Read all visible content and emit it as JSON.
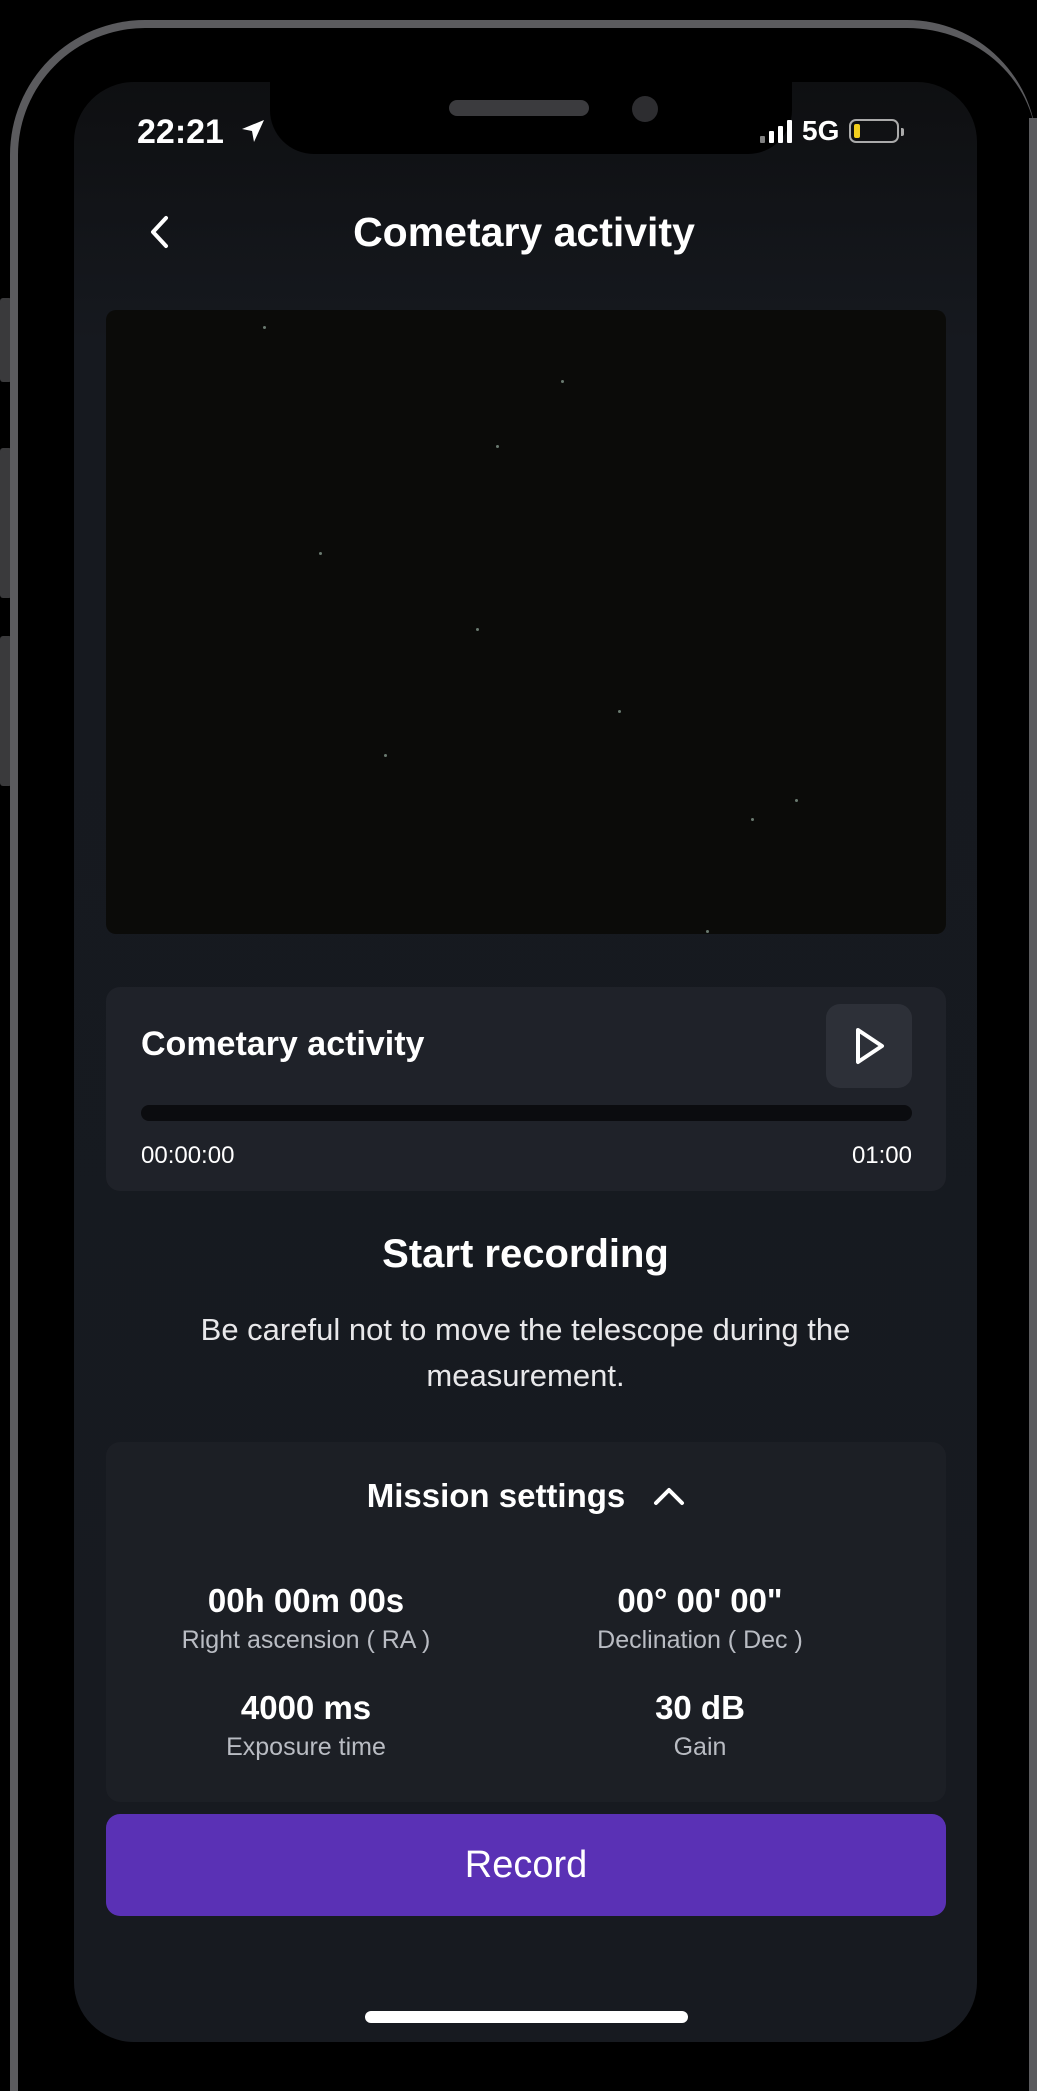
{
  "status_bar": {
    "time": "22:21",
    "network": "5G",
    "battery_level": 0.15,
    "battery_color": "#f2cf1e"
  },
  "header": {
    "title": "Cometary activity",
    "back_icon": "chevron-left-icon"
  },
  "recording": {
    "title": "Cometary activity",
    "play_icon": "play-icon",
    "progress": 0,
    "elapsed": "00:00:00",
    "duration": "01:00"
  },
  "instructions": {
    "heading": "Start recording",
    "description": "Be careful not to move the telescope during the measurement."
  },
  "mission_settings": {
    "title": "Mission settings",
    "toggle_icon": "chevron-up-icon",
    "ra_value": "00h 00m 00s",
    "ra_label": "Right ascension ( RA )",
    "dec_value": "00° 00' 00\"",
    "dec_label": "Declination ( Dec )",
    "exposure_value": "4000 ms",
    "exposure_label": "Exposure time",
    "gain_value": "30 dB",
    "gain_label": "Gain"
  },
  "actions": {
    "record_label": "Record",
    "accent_color": "#5a31b5"
  }
}
